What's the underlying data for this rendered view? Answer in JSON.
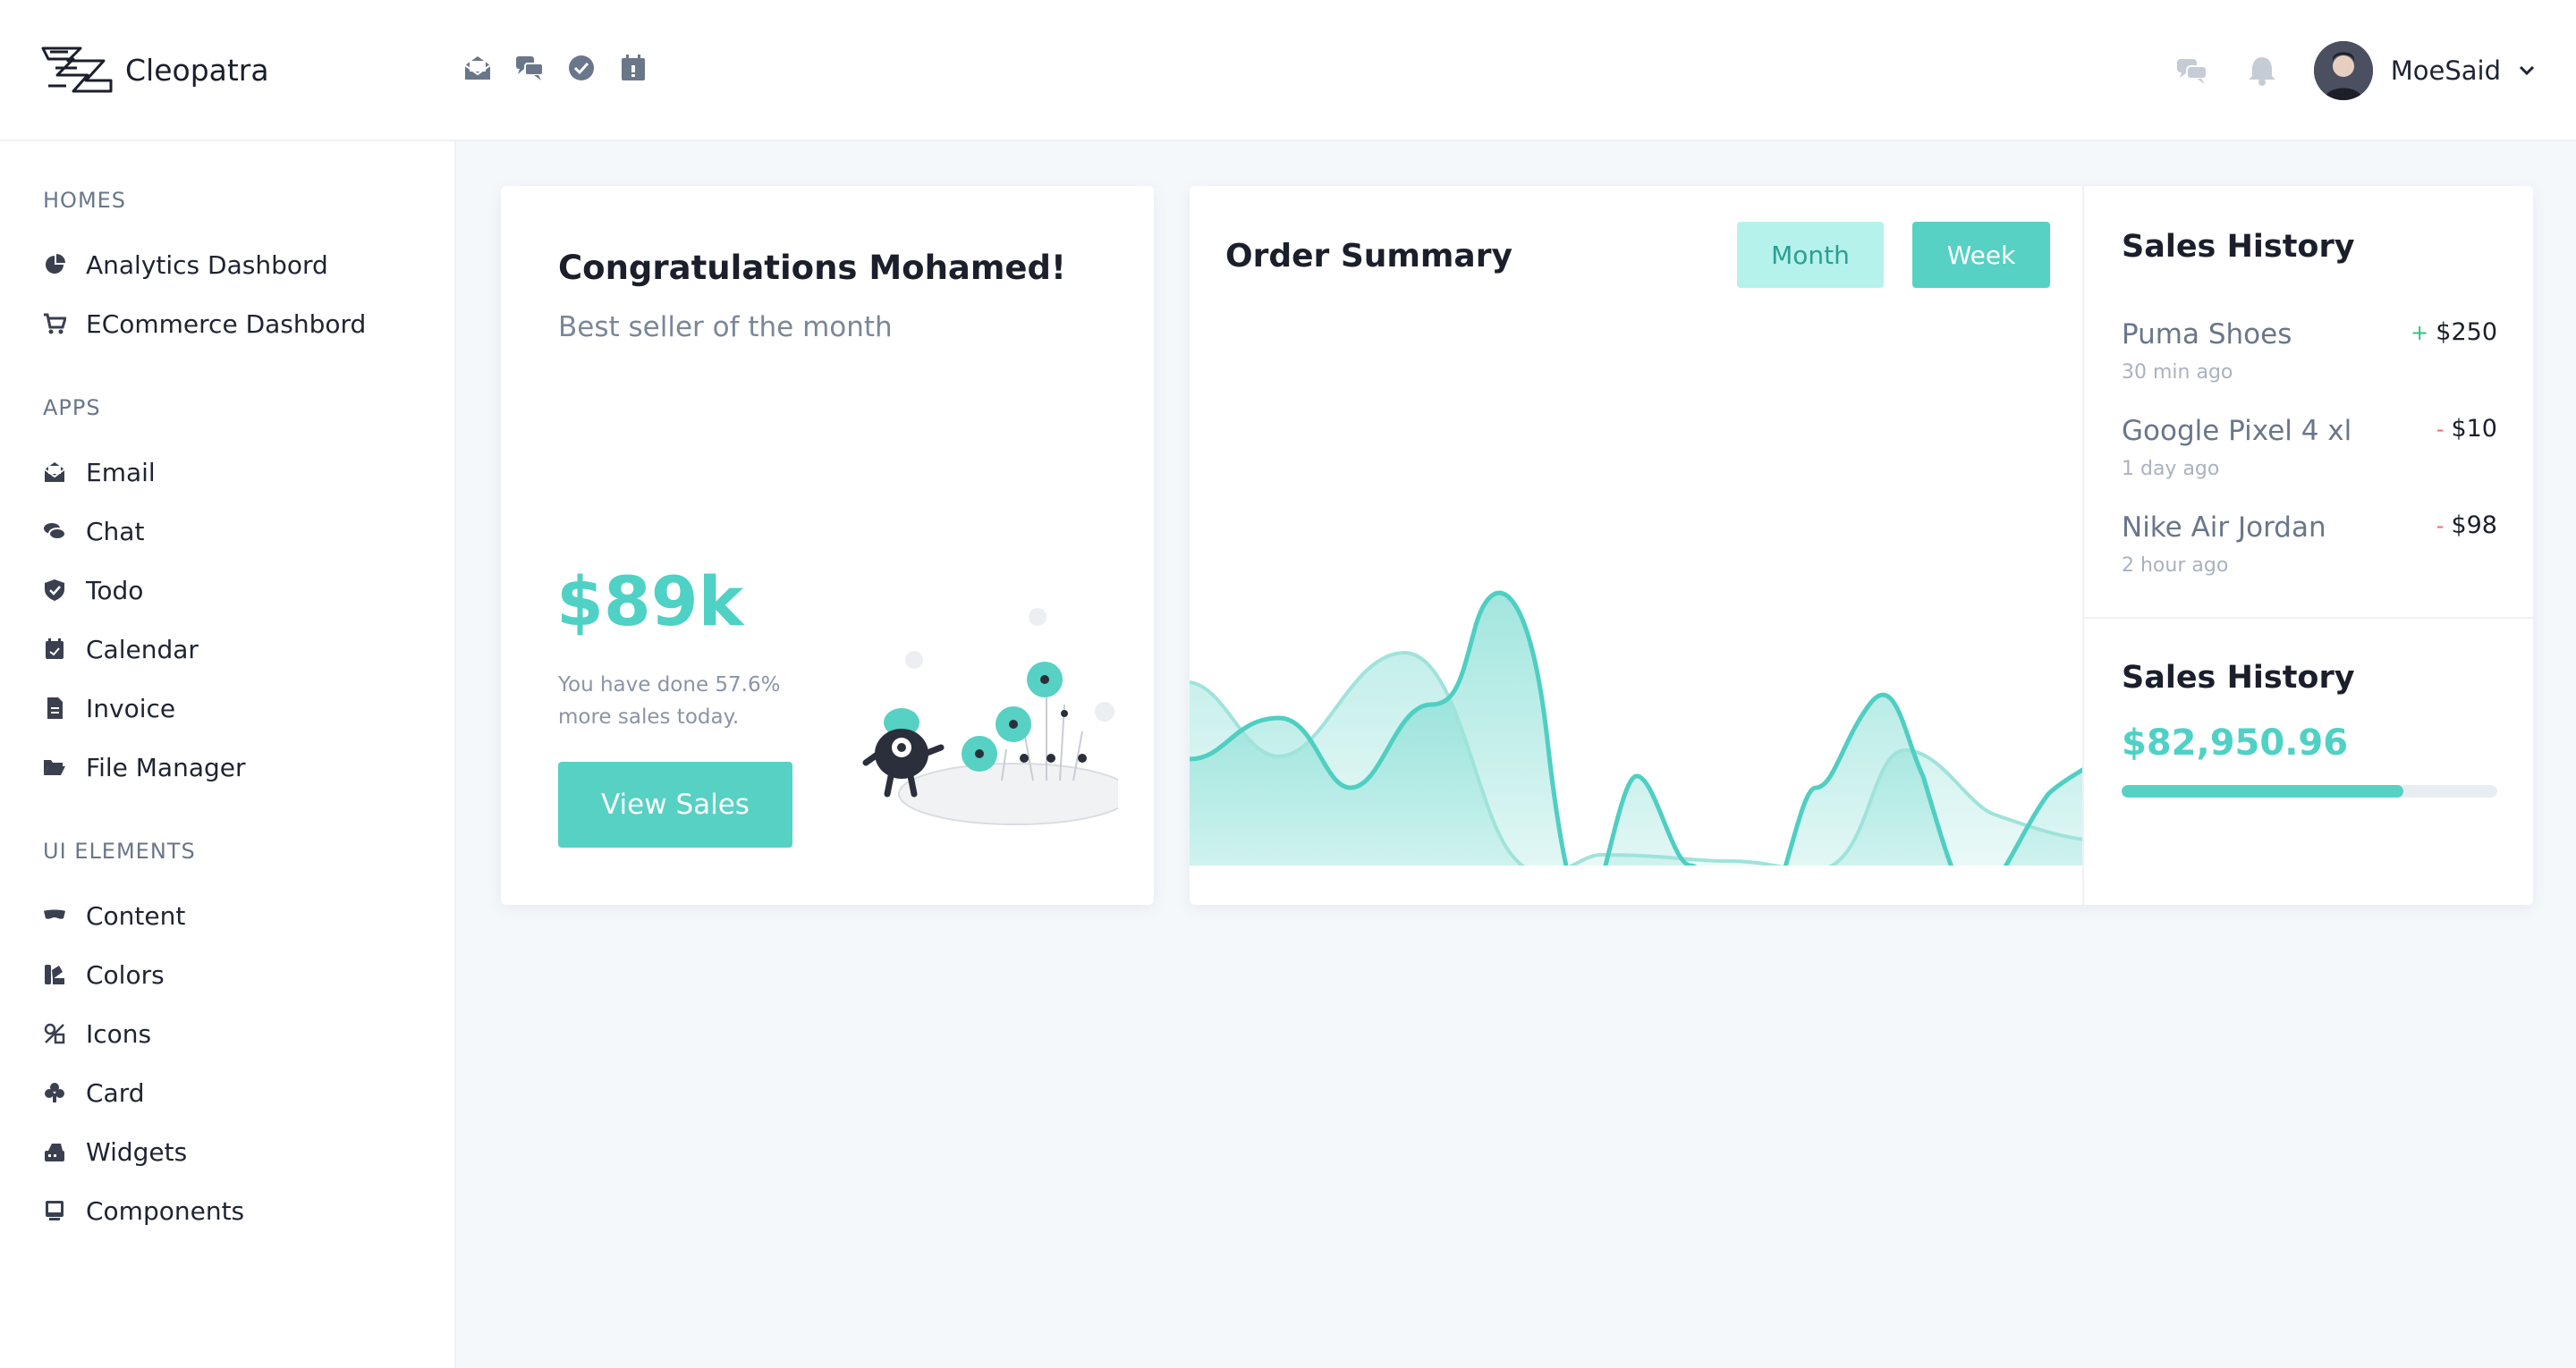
{
  "app": {
    "name": "Cleopatra"
  },
  "header": {
    "quick_apps": [
      {
        "icon": "email-icon"
      },
      {
        "icon": "chat-icon"
      },
      {
        "icon": "todo-check-icon"
      },
      {
        "icon": "calendar-icon"
      }
    ],
    "user": {
      "name": "MoeSaid"
    }
  },
  "sidebar": {
    "sections": [
      {
        "title": "HOMES",
        "items": [
          {
            "label": "Analytics Dashbord",
            "icon": "pie-chart-icon"
          },
          {
            "label": "ECommerce Dashbord",
            "icon": "cart-icon"
          }
        ]
      },
      {
        "title": "APPS",
        "items": [
          {
            "label": "Email",
            "icon": "envelope-open-icon"
          },
          {
            "label": "Chat",
            "icon": "comments-icon"
          },
          {
            "label": "Todo",
            "icon": "shield-check-icon"
          },
          {
            "label": "Calendar",
            "icon": "calendar-icon"
          },
          {
            "label": "Invoice",
            "icon": "file-invoice-icon"
          },
          {
            "label": "File Manager",
            "icon": "folder-open-icon"
          }
        ]
      },
      {
        "title": "UI ELEMENTS",
        "items": [
          {
            "label": "Content",
            "icon": "mask-icon"
          },
          {
            "label": "Colors",
            "icon": "palette-icon"
          },
          {
            "label": "Icons",
            "icon": "icons-icon"
          },
          {
            "label": "Card",
            "icon": "club-icon"
          },
          {
            "label": "Widgets",
            "icon": "widgets-icon"
          },
          {
            "label": "Components",
            "icon": "desktop-icon"
          }
        ]
      }
    ]
  },
  "congrats": {
    "title": "Congratulations Mohamed!",
    "subtitle": "Best seller of the month",
    "amount": "$89k",
    "note": "You have done 57.6% more sales today.",
    "button": "View Sales"
  },
  "order_summary": {
    "title": "Order Summary",
    "month_label": "Month",
    "week_label": "Week",
    "colors": {
      "accent": "#56d1c4",
      "accent_light": "#b5f2eb"
    }
  },
  "sales_history": {
    "title": "Sales History",
    "items": [
      {
        "name": "Puma Shoes",
        "time": "30 min ago",
        "sign": "+",
        "amount": "$250"
      },
      {
        "name": "Google Pixel 4 xl",
        "time": "1 day ago",
        "sign": "-",
        "amount": "$10"
      },
      {
        "name": "Nike Air Jordan",
        "time": "2 hour ago",
        "sign": "-",
        "amount": "$98"
      }
    ],
    "total_title": "Sales History",
    "total": "$82,950.96",
    "progress": 0.75
  }
}
